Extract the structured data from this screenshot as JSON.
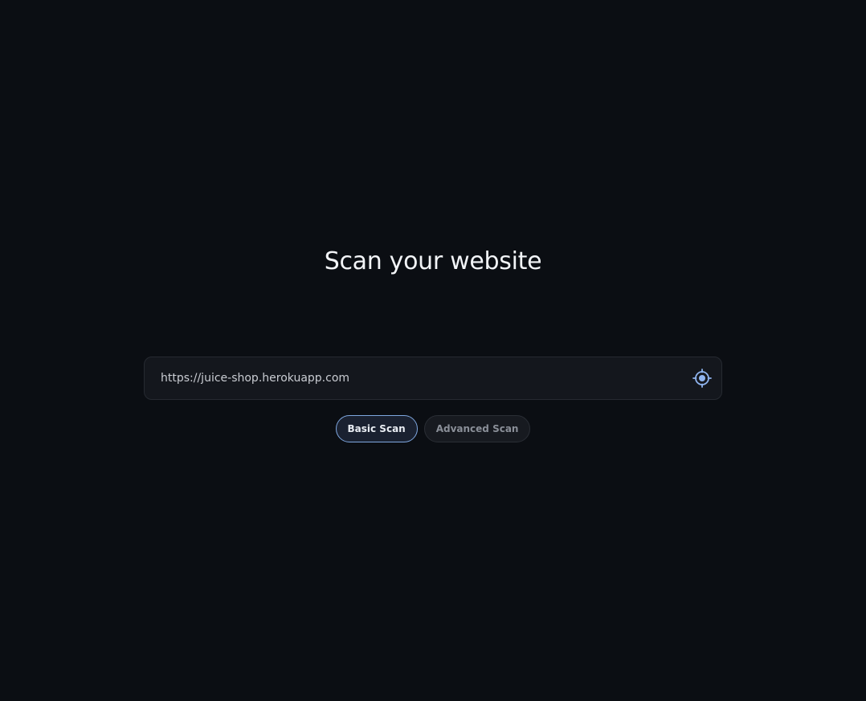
{
  "page": {
    "title": "Scan your website"
  },
  "scan_form": {
    "url_value": "https://juice-shop.herokuapp.com",
    "scan_icon": "target-icon",
    "modes": [
      {
        "label": "Basic Scan",
        "selected": true
      },
      {
        "label": "Advanced Scan",
        "selected": false
      }
    ]
  },
  "colors": {
    "background": "#0b0e13",
    "accent": "#7fa7e0"
  }
}
